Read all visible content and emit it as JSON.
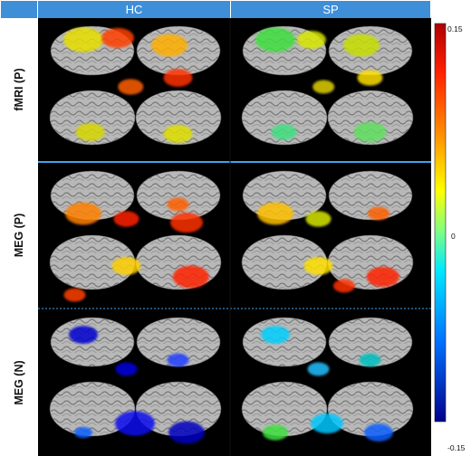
{
  "columns": {
    "hc": "HC",
    "sp": "SP"
  },
  "rows": [
    {
      "label": "fMRI (P)"
    },
    {
      "label": "MEG (P)"
    },
    {
      "label": "MEG (N)"
    }
  ],
  "colorbar": {
    "max_label": "0.15",
    "mid_label": "0",
    "min_label": "-0.15",
    "stops": [
      "#c00000",
      "#ff2000",
      "#ff8000",
      "#ffff00",
      "#60ff60",
      "#00e0ff",
      "#0060ff",
      "#0000a0"
    ]
  },
  "colors": {
    "header_bg": "#3e8ed8",
    "divider_blue": "#3fa2ee",
    "panel_bg": "#000000",
    "brain_base": "#b4b4b4"
  }
}
